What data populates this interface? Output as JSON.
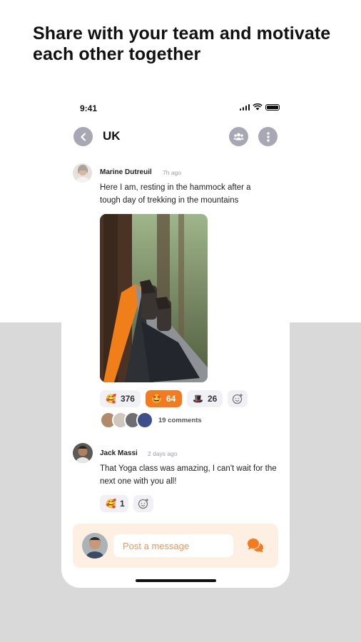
{
  "headline": "Share with your team and motivate each other together",
  "status_bar": {
    "time": "9:41"
  },
  "header": {
    "title": "UK",
    "back_icon": "chevron-left-icon",
    "team_icon": "users-icon",
    "menu_icon": "more-vertical-icon"
  },
  "posts": [
    {
      "author": "Marine Dutreuil",
      "time": "7h ago",
      "text": "Here I am, resting in the hammock after a tough day of trekking in the mountains",
      "image": "hammock-feet-forest-photo",
      "reactions": [
        {
          "emoji": "🥰",
          "count": "376",
          "active": false
        },
        {
          "emoji": "🤩",
          "count": "64",
          "active": true
        },
        {
          "emoji": "🎩",
          "count": "26",
          "active": false
        }
      ],
      "comments_label": "19 comments"
    },
    {
      "author": "Jack Massi",
      "time": "2 days ago",
      "text": "That Yoga class was amazing, I can't wait for the next one with you all!",
      "reactions": [
        {
          "emoji": "🥰",
          "count": "1",
          "active": false
        }
      ]
    }
  ],
  "composer": {
    "placeholder": "Post a message",
    "send_icon": "chat-bubbles-icon"
  },
  "colors": {
    "accent": "#f47a1f",
    "composer_bg": "#fdf0e2",
    "icon_gray": "#a8a8b4",
    "lower_bg": "#d9d9d9"
  }
}
